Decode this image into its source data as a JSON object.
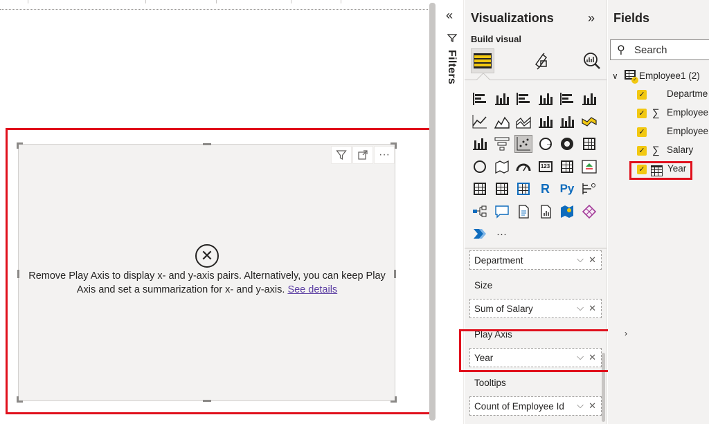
{
  "canvas": {
    "error_message": "Remove Play Axis to display x- and y-axis pairs. Alternatively, you can keep Play Axis and set a summarization for x- and y-axis.",
    "see_details_link": "See details",
    "visual_toolbar": {
      "filter_icon": "funnel-icon",
      "focus_icon": "focus-mode-icon",
      "more_icon": "more-options-icon",
      "more_glyph": "···"
    }
  },
  "filters": {
    "label": "Filters",
    "collapse_glyph": "«"
  },
  "visualizations": {
    "title": "Visualizations",
    "expand_glyph": "»",
    "build_visual_label": "Build visual",
    "more_visuals_glyph": "···",
    "wells": [
      {
        "label": "",
        "value": "Department"
      },
      {
        "label": "Size",
        "value": "Sum of Salary"
      },
      {
        "label": "Play Axis",
        "value": "Year"
      },
      {
        "label": "Tooltips",
        "value": "Count of Employee Id"
      }
    ]
  },
  "fields": {
    "title": "Fields",
    "search_placeholder": "Search",
    "table": {
      "name": "Employee1 (2)",
      "items": [
        {
          "name": "Departme",
          "sigma": false
        },
        {
          "name": "Employee",
          "sigma": true
        },
        {
          "name": "Employee",
          "sigma": false
        },
        {
          "name": "Salary",
          "sigma": true
        },
        {
          "name": "Year",
          "sigma": false
        }
      ]
    }
  },
  "colors": {
    "highlight": "#e0101c",
    "accent_yellow": "#f2c811",
    "link": "#5c3fa3"
  }
}
